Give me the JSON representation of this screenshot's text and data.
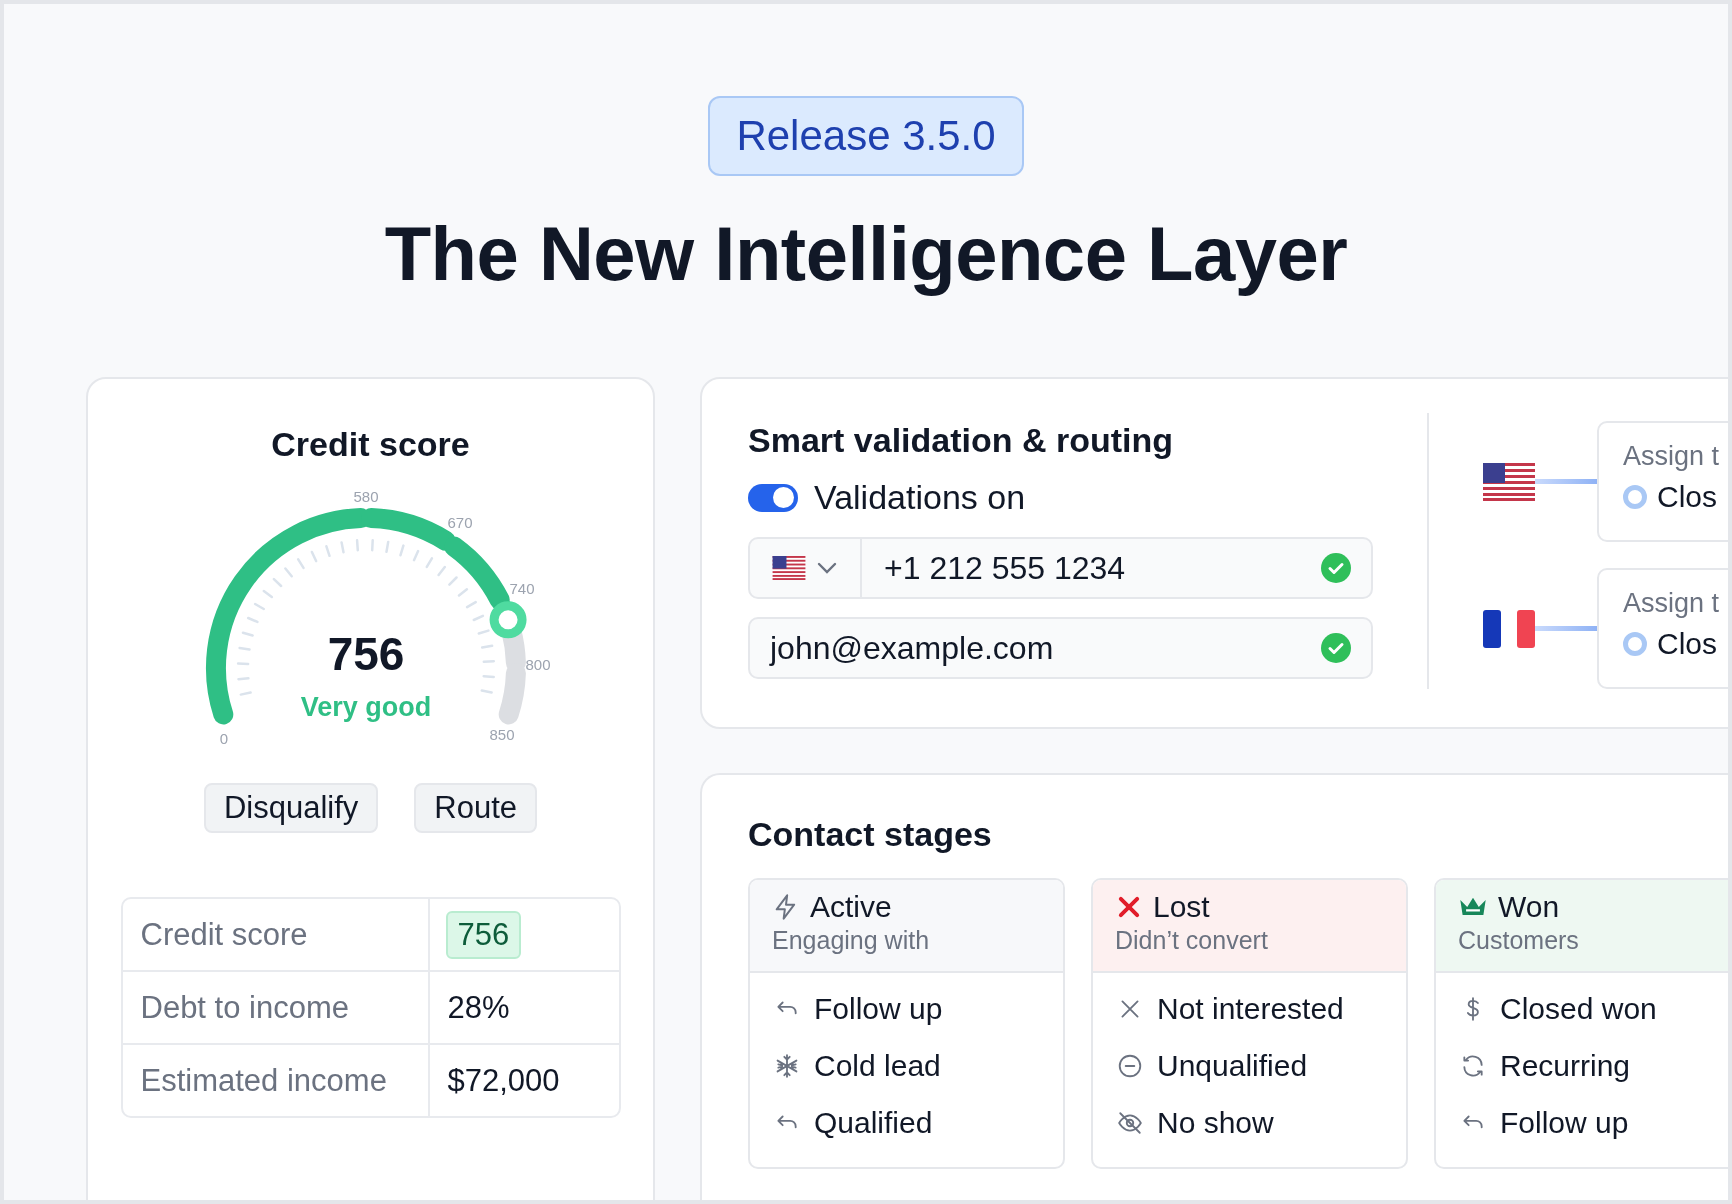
{
  "release_badge": "Release 3.5.0",
  "title": "The New Intelligence Layer",
  "credit": {
    "title": "Credit score",
    "gauge": {
      "score": "756",
      "rating": "Very good",
      "level": 0.83,
      "tick_labels": [
        "0",
        "580",
        "670",
        "740",
        "800",
        "850"
      ]
    },
    "buttons": [
      "Disqualify",
      "Route"
    ],
    "rows": [
      {
        "label": "Credit score",
        "value": "756",
        "highlighted": true
      },
      {
        "label": "Debt to income",
        "value": "28%",
        "highlighted": false
      },
      {
        "label": "Estimated income",
        "value": "$72,000",
        "highlighted": false
      }
    ]
  },
  "validation": {
    "title": "Smart validation & routing",
    "toggle": {
      "label": "Validations on",
      "on": true
    },
    "phone": {
      "kind": "us",
      "value": "+1 212 555 1234",
      "valid": true
    },
    "email": {
      "value": "john@example.com",
      "valid": true
    },
    "routes": [
      {
        "kind": "us",
        "assign_label": "Assign t",
        "option": "Clos",
        "selected": false
      },
      {
        "kind": "fr",
        "assign_label": "Assign t",
        "option": "Clos",
        "selected": false
      }
    ]
  },
  "stages": {
    "title": "Contact stages",
    "columns": [
      {
        "kind": "active",
        "title": "Active",
        "subtitle": "Engaging with",
        "items": [
          {
            "kind": "reply",
            "label": "Follow up"
          },
          {
            "kind": "snow",
            "label": "Cold lead"
          },
          {
            "kind": "reply",
            "label": "Qualified"
          }
        ]
      },
      {
        "kind": "lost",
        "title": "Lost",
        "subtitle": "Didn’t convert",
        "items": [
          {
            "kind": "cross",
            "label": "Not interested"
          },
          {
            "kind": "minus",
            "label": "Unqualified"
          },
          {
            "kind": "eye-off",
            "label": "No show"
          }
        ]
      },
      {
        "kind": "won",
        "title": "Won",
        "subtitle": "Customers",
        "items": [
          {
            "kind": "dollar",
            "label": "Closed won"
          },
          {
            "kind": "refresh",
            "label": "Recurring"
          },
          {
            "kind": "reply",
            "label": "Follow up"
          }
        ]
      }
    ]
  }
}
